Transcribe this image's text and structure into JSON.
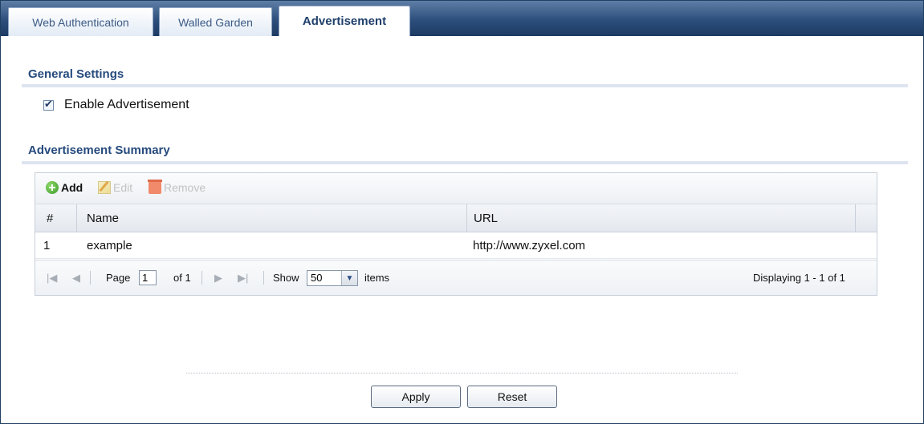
{
  "tabs": [
    {
      "label": "Web Authentication",
      "active": false
    },
    {
      "label": "Walled Garden",
      "active": false
    },
    {
      "label": "Advertisement",
      "active": true
    }
  ],
  "general": {
    "title": "General Settings",
    "enable_label": "Enable Advertisement",
    "enable_checked": true
  },
  "summary": {
    "title": "Advertisement Summary",
    "toolbar": {
      "add": "Add",
      "edit": "Edit",
      "remove": "Remove"
    },
    "columns": [
      "#",
      "Name",
      "URL"
    ],
    "rows": [
      {
        "index": "1",
        "name": "example",
        "url": "http://www.zyxel.com"
      }
    ],
    "pager": {
      "page_label": "Page",
      "page_value": "1",
      "of_label": "of 1",
      "show_label": "Show",
      "show_value": "50",
      "items_label": "items",
      "displaying": "Displaying 1 - 1 of 1"
    }
  },
  "buttons": {
    "apply": "Apply",
    "reset": "Reset"
  },
  "colors": {
    "accent": "#254a7d",
    "tabbar": "#2d4f7c"
  }
}
